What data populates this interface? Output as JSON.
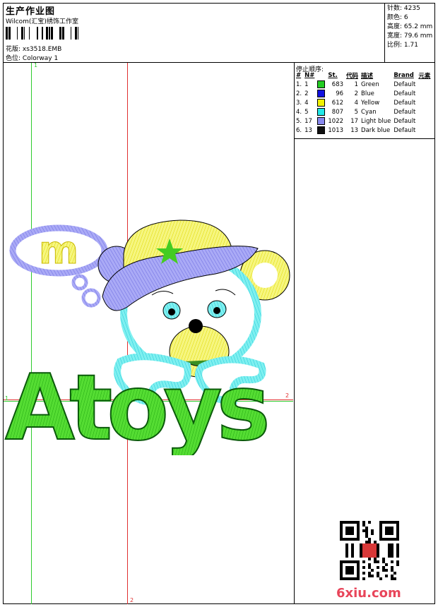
{
  "header": {
    "title": "生产作业图",
    "company": "Wilcom(汇宝)绣饰工作室",
    "design_label": "花版:",
    "design_file": "xs3518.EMB",
    "colorway_label": "色位:",
    "colorway": "Colorway 1"
  },
  "stats": {
    "stitches": "针数: 4235",
    "colors": "颜色: 6",
    "height": "高度: 65.2 mm",
    "width": "宽度: 79.6 mm",
    "scale": "比例: 1.71"
  },
  "stop_sequence": {
    "title": "停止顺序:",
    "headers": [
      "#",
      "N#",
      "St.",
      "代码",
      "描述",
      "Brand",
      "元素"
    ],
    "rows": [
      {
        "idx": "1.",
        "n": "1",
        "color": "#22cc22",
        "st": "683",
        "code": "1",
        "desc": "Green",
        "brand": "Default"
      },
      {
        "idx": "2.",
        "n": "2",
        "color": "#1010e0",
        "st": "96",
        "code": "2",
        "desc": "Blue",
        "brand": "Default"
      },
      {
        "idx": "3.",
        "n": "4",
        "color": "#f2f200",
        "st": "612",
        "code": "4",
        "desc": "Yellow",
        "brand": "Default"
      },
      {
        "idx": "4.",
        "n": "5",
        "color": "#22e8e8",
        "st": "807",
        "code": "5",
        "desc": "Cyan",
        "brand": "Default"
      },
      {
        "idx": "5.",
        "n": "17",
        "color": "#8888ee",
        "st": "1022",
        "code": "17",
        "desc": "Light blue",
        "brand": "Default"
      },
      {
        "idx": "6.",
        "n": "13",
        "color": "#101010",
        "st": "1013",
        "code": "13",
        "desc": "Dark blue",
        "brand": "Default"
      }
    ]
  },
  "guides": {
    "v1": "1",
    "v2": "2",
    "h1": "1",
    "h2": "2"
  },
  "artwork": {
    "text": "Atoys",
    "bubble_text": "m"
  },
  "watermark": "6xiu.com"
}
